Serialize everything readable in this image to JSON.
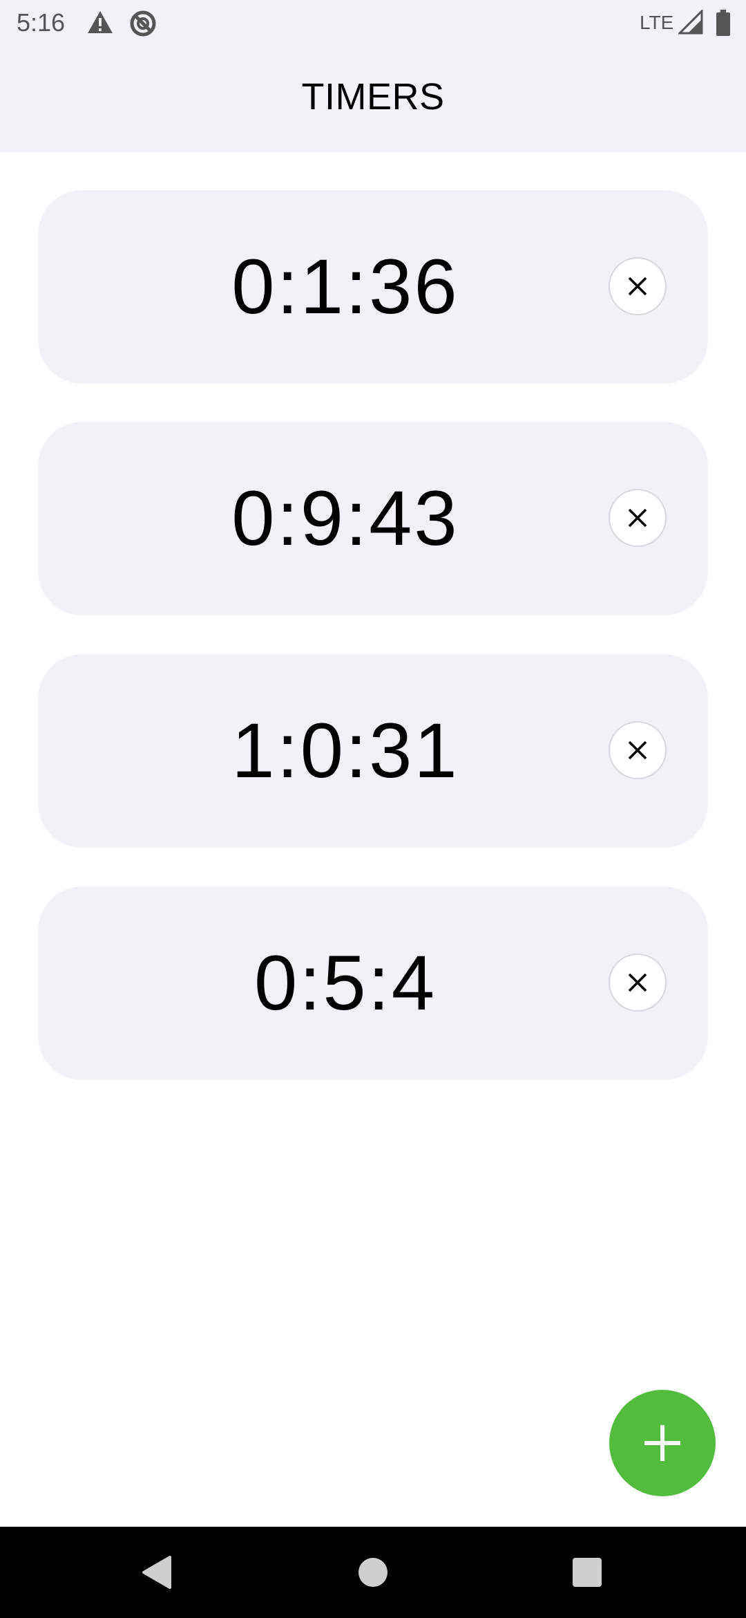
{
  "status_bar": {
    "time": "5:16",
    "network": "LTE",
    "icons": [
      "warning-icon",
      "blocked-sync-icon",
      "signal-icon",
      "battery-icon"
    ]
  },
  "header": {
    "title": "TIMERS"
  },
  "timers": [
    {
      "value": "0:1:36"
    },
    {
      "value": "0:9:43"
    },
    {
      "value": "1:0:31"
    },
    {
      "value": "0:5:4"
    }
  ],
  "fab": {
    "icon": "plus-icon",
    "color": "#52bc3e"
  },
  "nav_bar": {
    "icons": [
      "back-icon",
      "home-icon",
      "recents-icon"
    ]
  },
  "colors": {
    "card_background": "#f2f2f6",
    "accent": "#52bc3e"
  }
}
